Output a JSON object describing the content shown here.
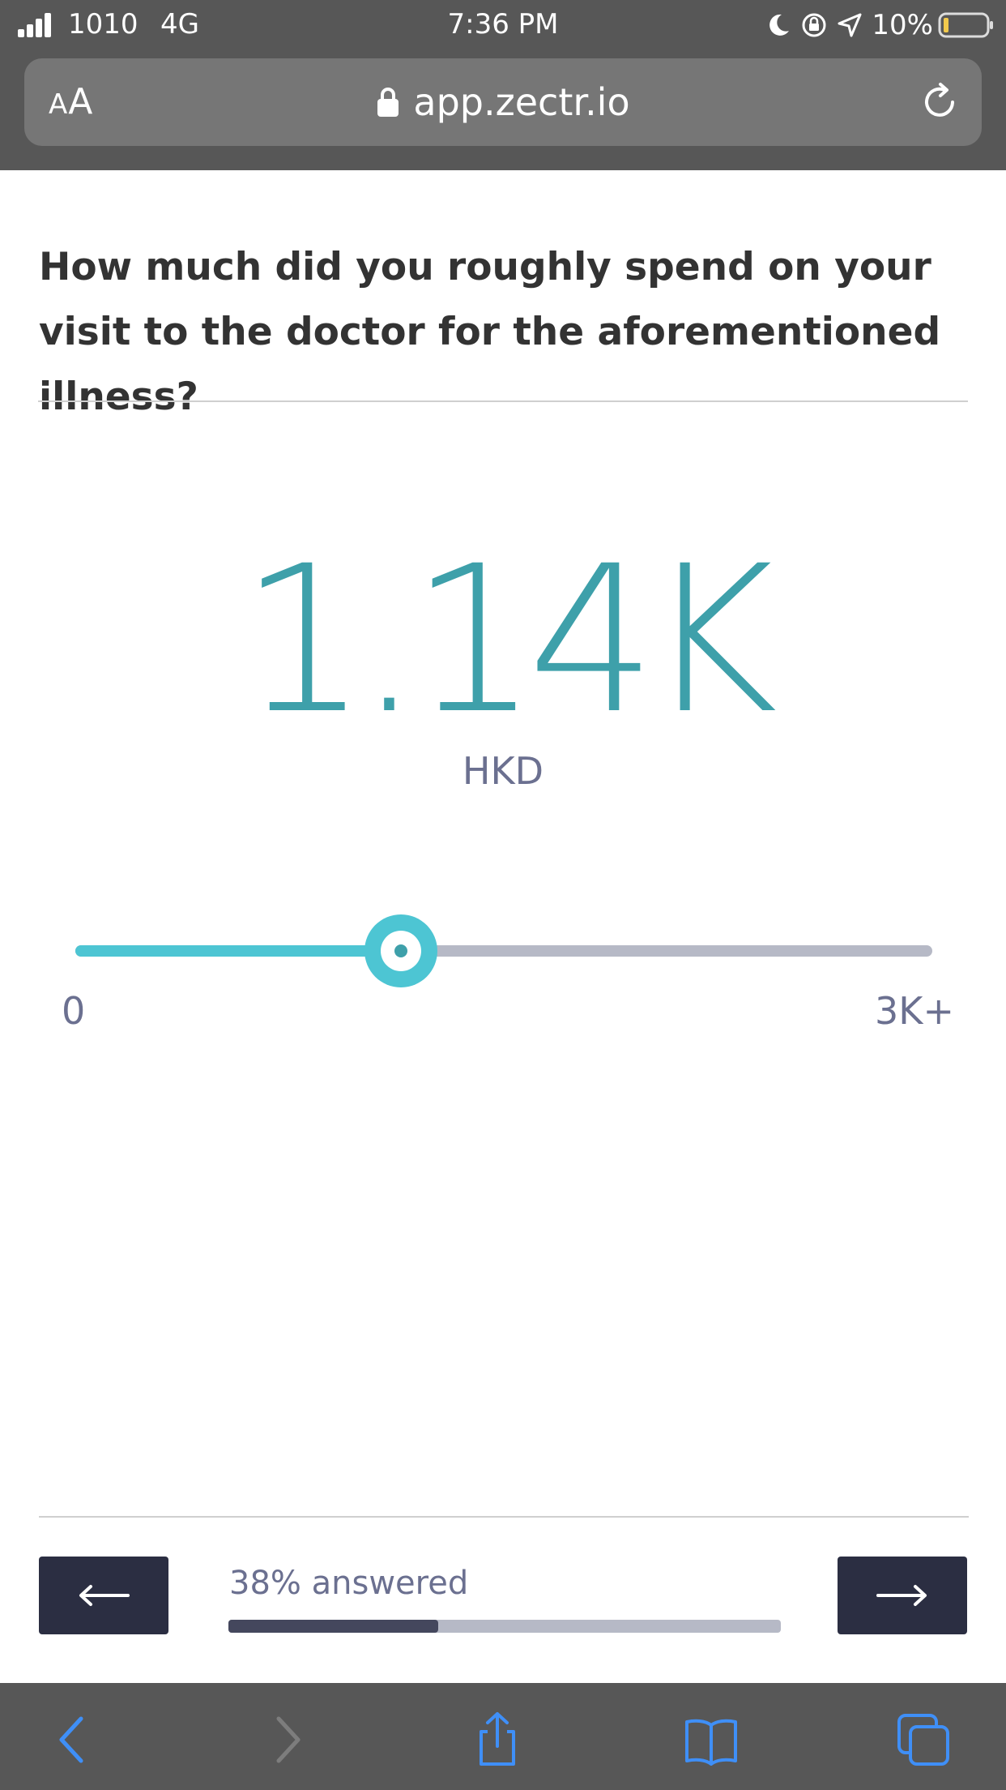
{
  "status_bar": {
    "carrier": "1010",
    "network": "4G",
    "time": "7:36 PM",
    "battery": "10%"
  },
  "url_bar": {
    "aa_label_small": "A",
    "aa_label_large": "A",
    "url": "app.zectr.io"
  },
  "question": {
    "text": "How much did you roughly spend on your visit to the doctor for the aforementioned illness?"
  },
  "answer": {
    "value": "1.14K",
    "currency": "HKD"
  },
  "slider": {
    "min_label": "0",
    "max_label": "3K+",
    "fraction": 0.38,
    "fill_color": "#4dc5d3",
    "track_color": "#b6b9c6"
  },
  "navigation": {
    "prev_icon": "arrow-left-icon",
    "next_icon": "arrow-right-icon"
  },
  "progress": {
    "label": "38% answered",
    "fraction": 0.38
  },
  "toolbar": {
    "icons": [
      "back-icon",
      "forward-icon",
      "share-icon",
      "bookmarks-icon",
      "tabs-icon"
    ],
    "accent_color": "#3f8ff7"
  },
  "colors": {
    "accent": "#3ea0aa",
    "chrome": "#575757",
    "button_dark": "#2b2e42"
  }
}
